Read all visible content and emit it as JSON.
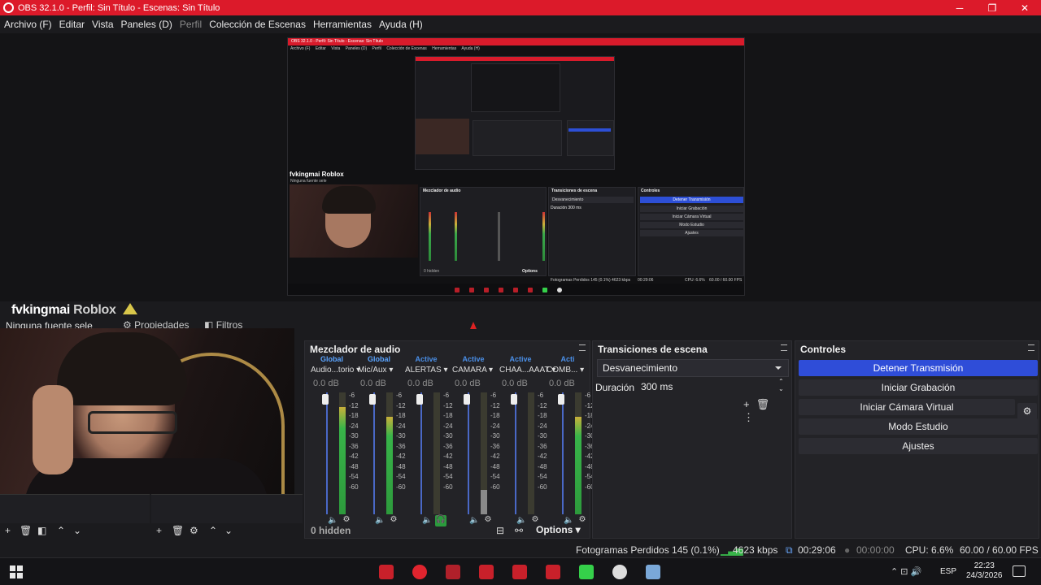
{
  "window": {
    "title": "OBS 32.1.0 - Perfil: Sin Título - Escenas: Sin Título",
    "minimize": "─",
    "maximize": "❐",
    "close": "✕"
  },
  "menu": [
    {
      "label": "Archivo (F)"
    },
    {
      "label": "Editar"
    },
    {
      "label": "Vista"
    },
    {
      "label": "Paneles (D)"
    },
    {
      "label": "Perfil",
      "disabled": true
    },
    {
      "label": "Colección de Escenas"
    },
    {
      "label": "Herramientas"
    },
    {
      "label": "Ayuda (H)"
    }
  ],
  "nested_preview": {
    "title": "OBS 32.1.0 - Perfil: Sin Título - Escenas: Sin Título",
    "menu": [
      "Archivo (F)",
      "Editar",
      "Vista",
      "Paneles (D)",
      "Perfil",
      "Colección de Escenas",
      "Herramientas",
      "Ayuda (H)"
    ],
    "brand": "fvkingmai Roblox",
    "no_source": "Ninguna fuente sele",
    "mixer_title": "Mezclador de audio",
    "transitions_title": "Transiciones de escena",
    "transition": "Desvanecimiento",
    "duration": "Duración  300 ms",
    "controls_title": "Controles",
    "controls": [
      "Detener Transmisión",
      "Iniciar Grabación",
      "Iniciar Cámara Virtual",
      "Modo Estudio",
      "Ajustes"
    ],
    "hidden": "0 hidden",
    "options": "Options",
    "status": "Fotogramas Perdidos 145 (0.1%)   4623 kbps",
    "time": "00:29:06",
    "cpu": "CPU: 6.6%",
    "fps": "60.00 / 60.00 FPS"
  },
  "source": {
    "brand_name": "fvkingmai",
    "brand_game": "Roblox",
    "no_source": "Ninguna fuente sele",
    "properties": "Propiedades",
    "filters": "Filtros"
  },
  "mixer": {
    "title": "Mezclador de audio",
    "hidden": "0 hidden",
    "options": "Options",
    "ticks": [
      "-6",
      "-12",
      "-18",
      "-24",
      "-30",
      "-36",
      "-42",
      "-48",
      "-54",
      "-60"
    ],
    "channels": [
      {
        "tag": "Global",
        "name": "Audio...torio",
        "db": "0.0 dB",
        "level": 0.88,
        "muted": false
      },
      {
        "tag": "Global",
        "name": "Mic/Aux",
        "db": "0.0 dB",
        "level": 0.8,
        "muted": false
      },
      {
        "tag": "Active",
        "name": "ALERTAS",
        "db": "0.0 dB",
        "level": 0.0,
        "muted": true,
        "monitor": true
      },
      {
        "tag": "Active",
        "name": "CAMARA",
        "db": "0.0 dB",
        "level": 0.2,
        "muted": true
      },
      {
        "tag": "Active",
        "name": "CHAA...AAAT",
        "db": "0.0 dB",
        "level": 0.0,
        "muted": false
      },
      {
        "tag": "Acti",
        "name": "COMB...",
        "db": "0.0 dB",
        "level": 0.8,
        "muted": false
      }
    ]
  },
  "transitions": {
    "title": "Transiciones de escena",
    "selected": "Desvanecimiento",
    "duration_label": "Duración",
    "duration_value": "300 ms"
  },
  "controls": {
    "title": "Controles",
    "stop_stream": "Detener Transmisión",
    "start_recording": "Iniciar Grabación",
    "start_virtualcam": "Iniciar Cámara Virtual",
    "studio_mode": "Modo Estudio",
    "settings": "Ajustes"
  },
  "status": {
    "dropped": "Fotogramas Perdidos 145 (0.1%)",
    "bitrate": "4623 kbps",
    "stream_time": "00:29:06",
    "rec_time": "00:00:00",
    "cpu": "CPU: 6.6%",
    "fps": "60.00 / 60.00 FPS"
  },
  "taskbar": {
    "language": "ESP",
    "time": "22:23",
    "date": "24/3/2026",
    "apps": [
      {
        "name": "app-red-1",
        "color": "#c8202a"
      },
      {
        "name": "opera",
        "color": "#e0242e"
      },
      {
        "name": "app-red-3",
        "color": "#b0202a"
      },
      {
        "name": "app-red-4",
        "color": "#c8202a"
      },
      {
        "name": "app-red-5",
        "color": "#c8202a"
      },
      {
        "name": "app-red-6",
        "color": "#c8202a"
      },
      {
        "name": "kick",
        "color": "#35d04a"
      },
      {
        "name": "obs",
        "color": "#dddddd"
      },
      {
        "name": "steam",
        "color": "#7aa8d8"
      }
    ]
  },
  "colors": {
    "accent": "#2f4dd8",
    "title_red": "#dc1a2a",
    "meter_green": "#38b449"
  }
}
